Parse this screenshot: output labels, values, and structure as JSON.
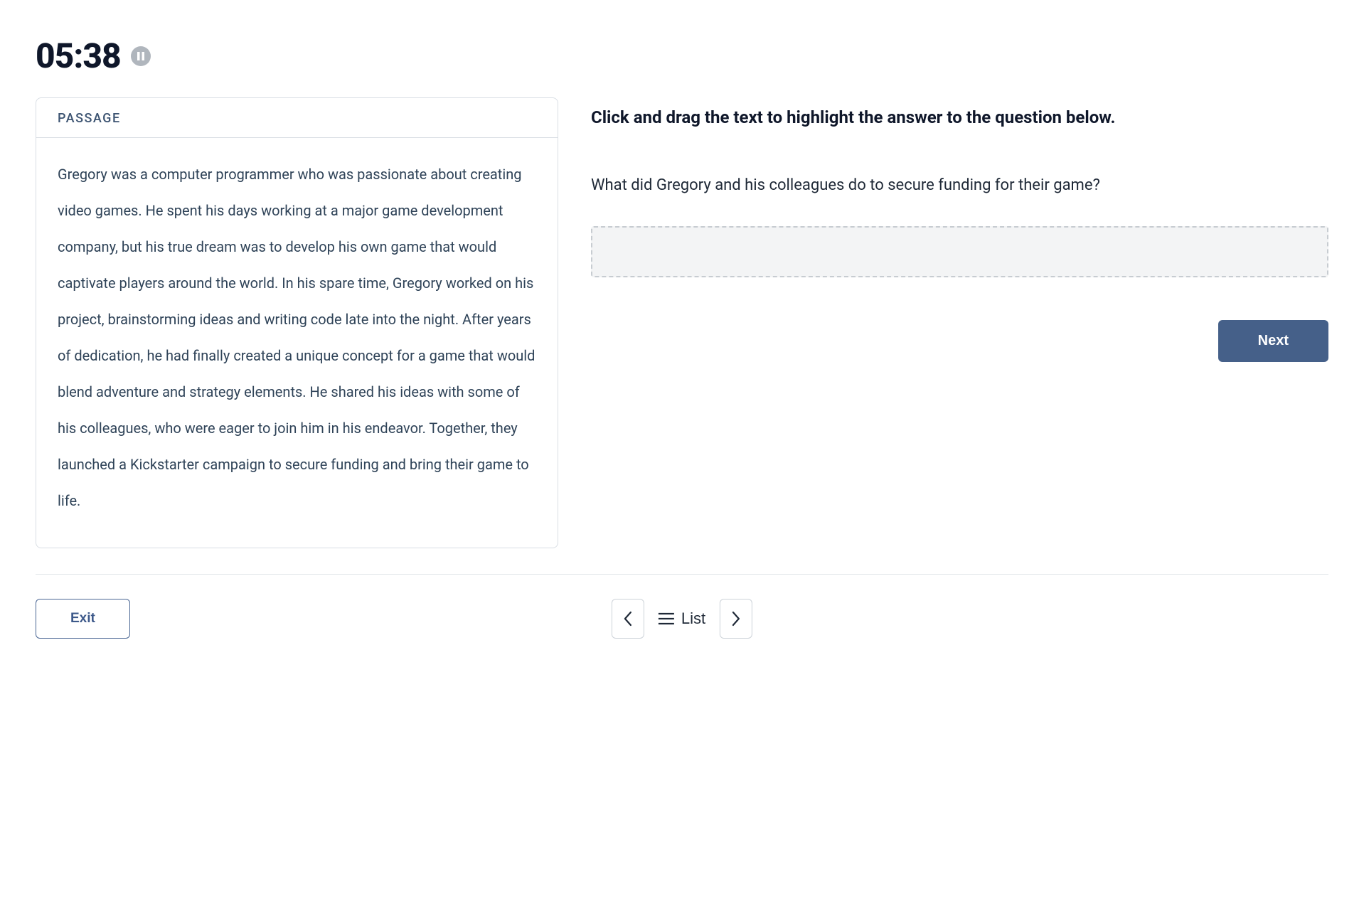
{
  "timer": "05:38",
  "passage": {
    "header_label": "PASSAGE",
    "text": "Gregory was a computer programmer who was passionate about creating video games. He spent his days working at a major game development company, but his true dream was to develop his own game that would captivate players around the world. In his spare time, Gregory worked on his project, brainstorming ideas and writing code late into the night. After years of dedication, he had finally created a unique concept for a game that would blend adventure and strategy elements. He shared his ideas with some of his colleagues, who were eager to join him in his endeavor. Together, they launched a Kickstarter campaign to secure funding and bring their game to life."
  },
  "question_pane": {
    "instruction": "Click and drag the text to highlight the answer to the question below.",
    "question": "What did Gregory and his colleagues do to secure funding for their game?",
    "next_label": "Next"
  },
  "footer": {
    "exit_label": "Exit",
    "list_label": "List"
  }
}
